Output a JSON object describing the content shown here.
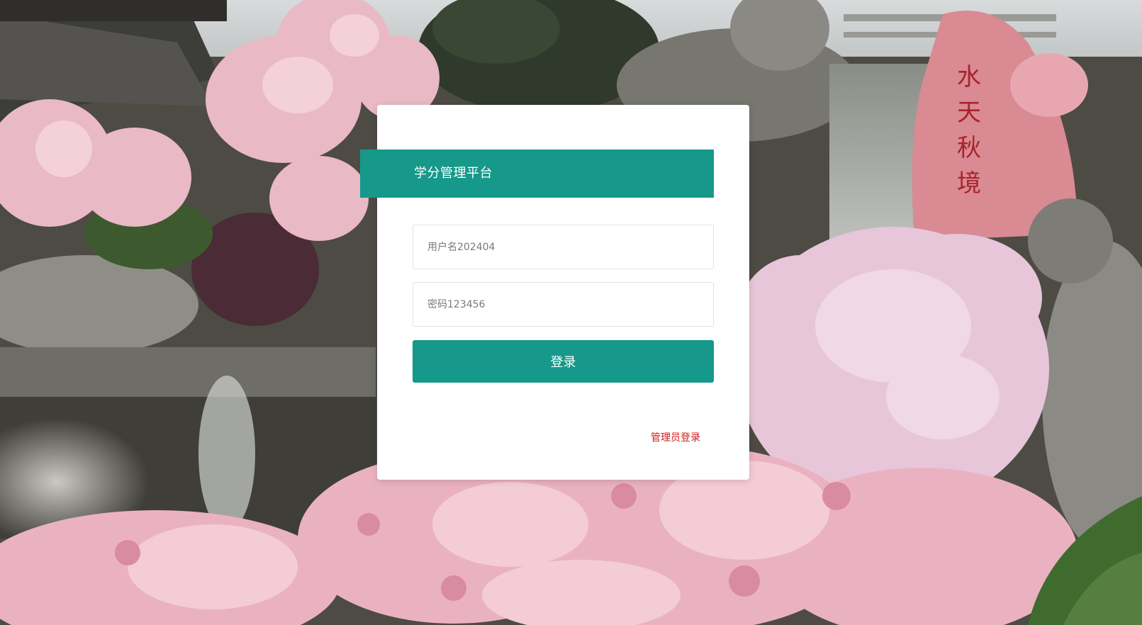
{
  "header": {
    "title": "学分管理平台"
  },
  "form": {
    "username_placeholder": "用户名202404",
    "password_placeholder": "密码123456",
    "login_label": "登录",
    "admin_login_label": "管理员登录"
  },
  "background": {
    "description_icon": "garden-photo",
    "rock_inscription": "水天秋境"
  },
  "colors": {
    "accent": "#16998a",
    "admin_link": "#d21b1b",
    "card": "#ffffff"
  }
}
